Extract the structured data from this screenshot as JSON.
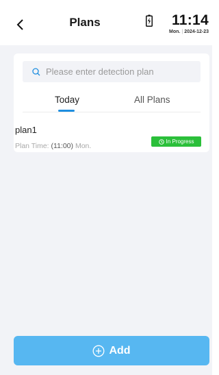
{
  "header": {
    "title": "Plans",
    "time": "11:14",
    "day": "Mon.",
    "date": "2024-12-23"
  },
  "search": {
    "placeholder": "Please enter detection plan",
    "value": ""
  },
  "tabs": [
    {
      "label": "Today",
      "active": true
    },
    {
      "label": "All Plans",
      "active": false
    }
  ],
  "plans": [
    {
      "name": "plan1",
      "time_label": "Plan Time:",
      "time_value": "(11:00)",
      "day": "Mon.",
      "status": "In Progress"
    }
  ],
  "footer": {
    "add_label": "Add"
  },
  "colors": {
    "accent": "#1e8ee0",
    "add_button": "#57b7f1",
    "status_green": "#2bbf3a",
    "content_bg": "#f2f3f7"
  },
  "icons": {
    "back": "chevron-left-icon",
    "battery": "battery-charging-icon",
    "search": "search-icon",
    "status": "clock-icon",
    "add": "plus-circle-icon"
  }
}
